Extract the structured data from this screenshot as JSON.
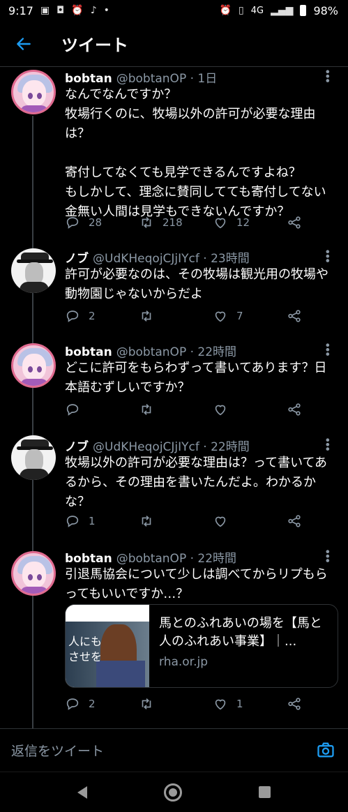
{
  "status_bar": {
    "time": "9:17",
    "network": "4G",
    "battery": "98%"
  },
  "header": {
    "title": "ツイート"
  },
  "tweets": [
    {
      "name": "bobtan",
      "handle": "@bobtanOP · 1日",
      "text": "なんでなんですか？\n牧場行くのに、牧場以外の許可が必要な理由は？\n\n寄付してなくても見学できるんですよね？\nもしかして、理念に賛同してても寄付してない金無い人間は見学もできないんですか？",
      "replies": "28",
      "retweets": "218",
      "likes": "12"
    },
    {
      "name": "ノブ",
      "handle": "@UdKHeqojCJjIYcf · 23時間",
      "text": "許可が必要なのは、その牧場は観光用の牧場や動物園じゃないからだよ",
      "replies": "2",
      "retweets": "",
      "likes": "7"
    },
    {
      "name": "bobtan",
      "handle": "@bobtanOP · 22時間",
      "text": "どこに許可をもらわずって書いてあります？日本語むずしいですか？",
      "replies": "",
      "retweets": "",
      "likes": ""
    },
    {
      "name": "ノブ",
      "handle": "@UdKHeqojCJjIYcf · 22時間",
      "text": "牧場以外の許可が必要な理由は？って書いてあるから、その理由を書いたんだよ。わかるかな？",
      "replies": "1",
      "retweets": "",
      "likes": ""
    },
    {
      "name": "bobtan",
      "handle": "@bobtanOP · 22時間",
      "text": "引退馬協会について少しは調べてからリプもらってもいいですか…？",
      "replies": "2",
      "retweets": "",
      "likes": "1",
      "card": {
        "thumb_overlay": "人にも\nさせを",
        "title": "馬とのふれあいの場を【馬と人のふれあい事業】｜...",
        "domain": "rha.or.jp"
      }
    }
  ],
  "reply_bar": {
    "placeholder": "返信をツイート"
  },
  "icons": {
    "back": "arrow-left-icon",
    "reply": "reply-icon",
    "retweet": "retweet-icon",
    "like": "heart-icon",
    "share": "share-icon",
    "camera": "camera-icon"
  },
  "colors": {
    "accent": "#1d9bf0",
    "muted": "#8b98a5",
    "divider": "#2f3336"
  }
}
